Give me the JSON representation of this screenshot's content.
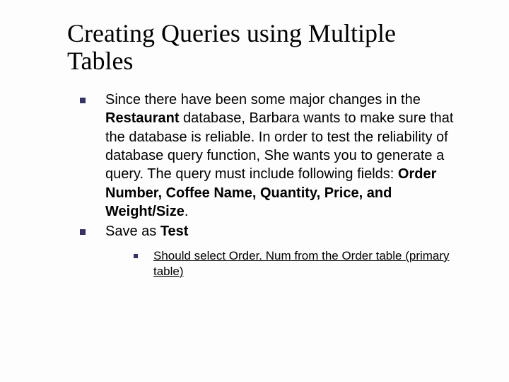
{
  "title": "Creating Queries using Multiple Tables",
  "bullets": [
    {
      "html": "Since there have been some major changes in the <b>Restaurant</b> database, Barbara wants to make sure that the database is reliable. In order to test the reliability of database query function, She wants you to generate a query. The query must include following fields: <b>Order Number, Coffee Name, Quantity, Price, and Weight/Size</b>."
    },
    {
      "html": "Save as <b>Test</b>",
      "sub": [
        {
          "text": "Should select Order. Num from the Order table (primary table)"
        }
      ]
    }
  ]
}
